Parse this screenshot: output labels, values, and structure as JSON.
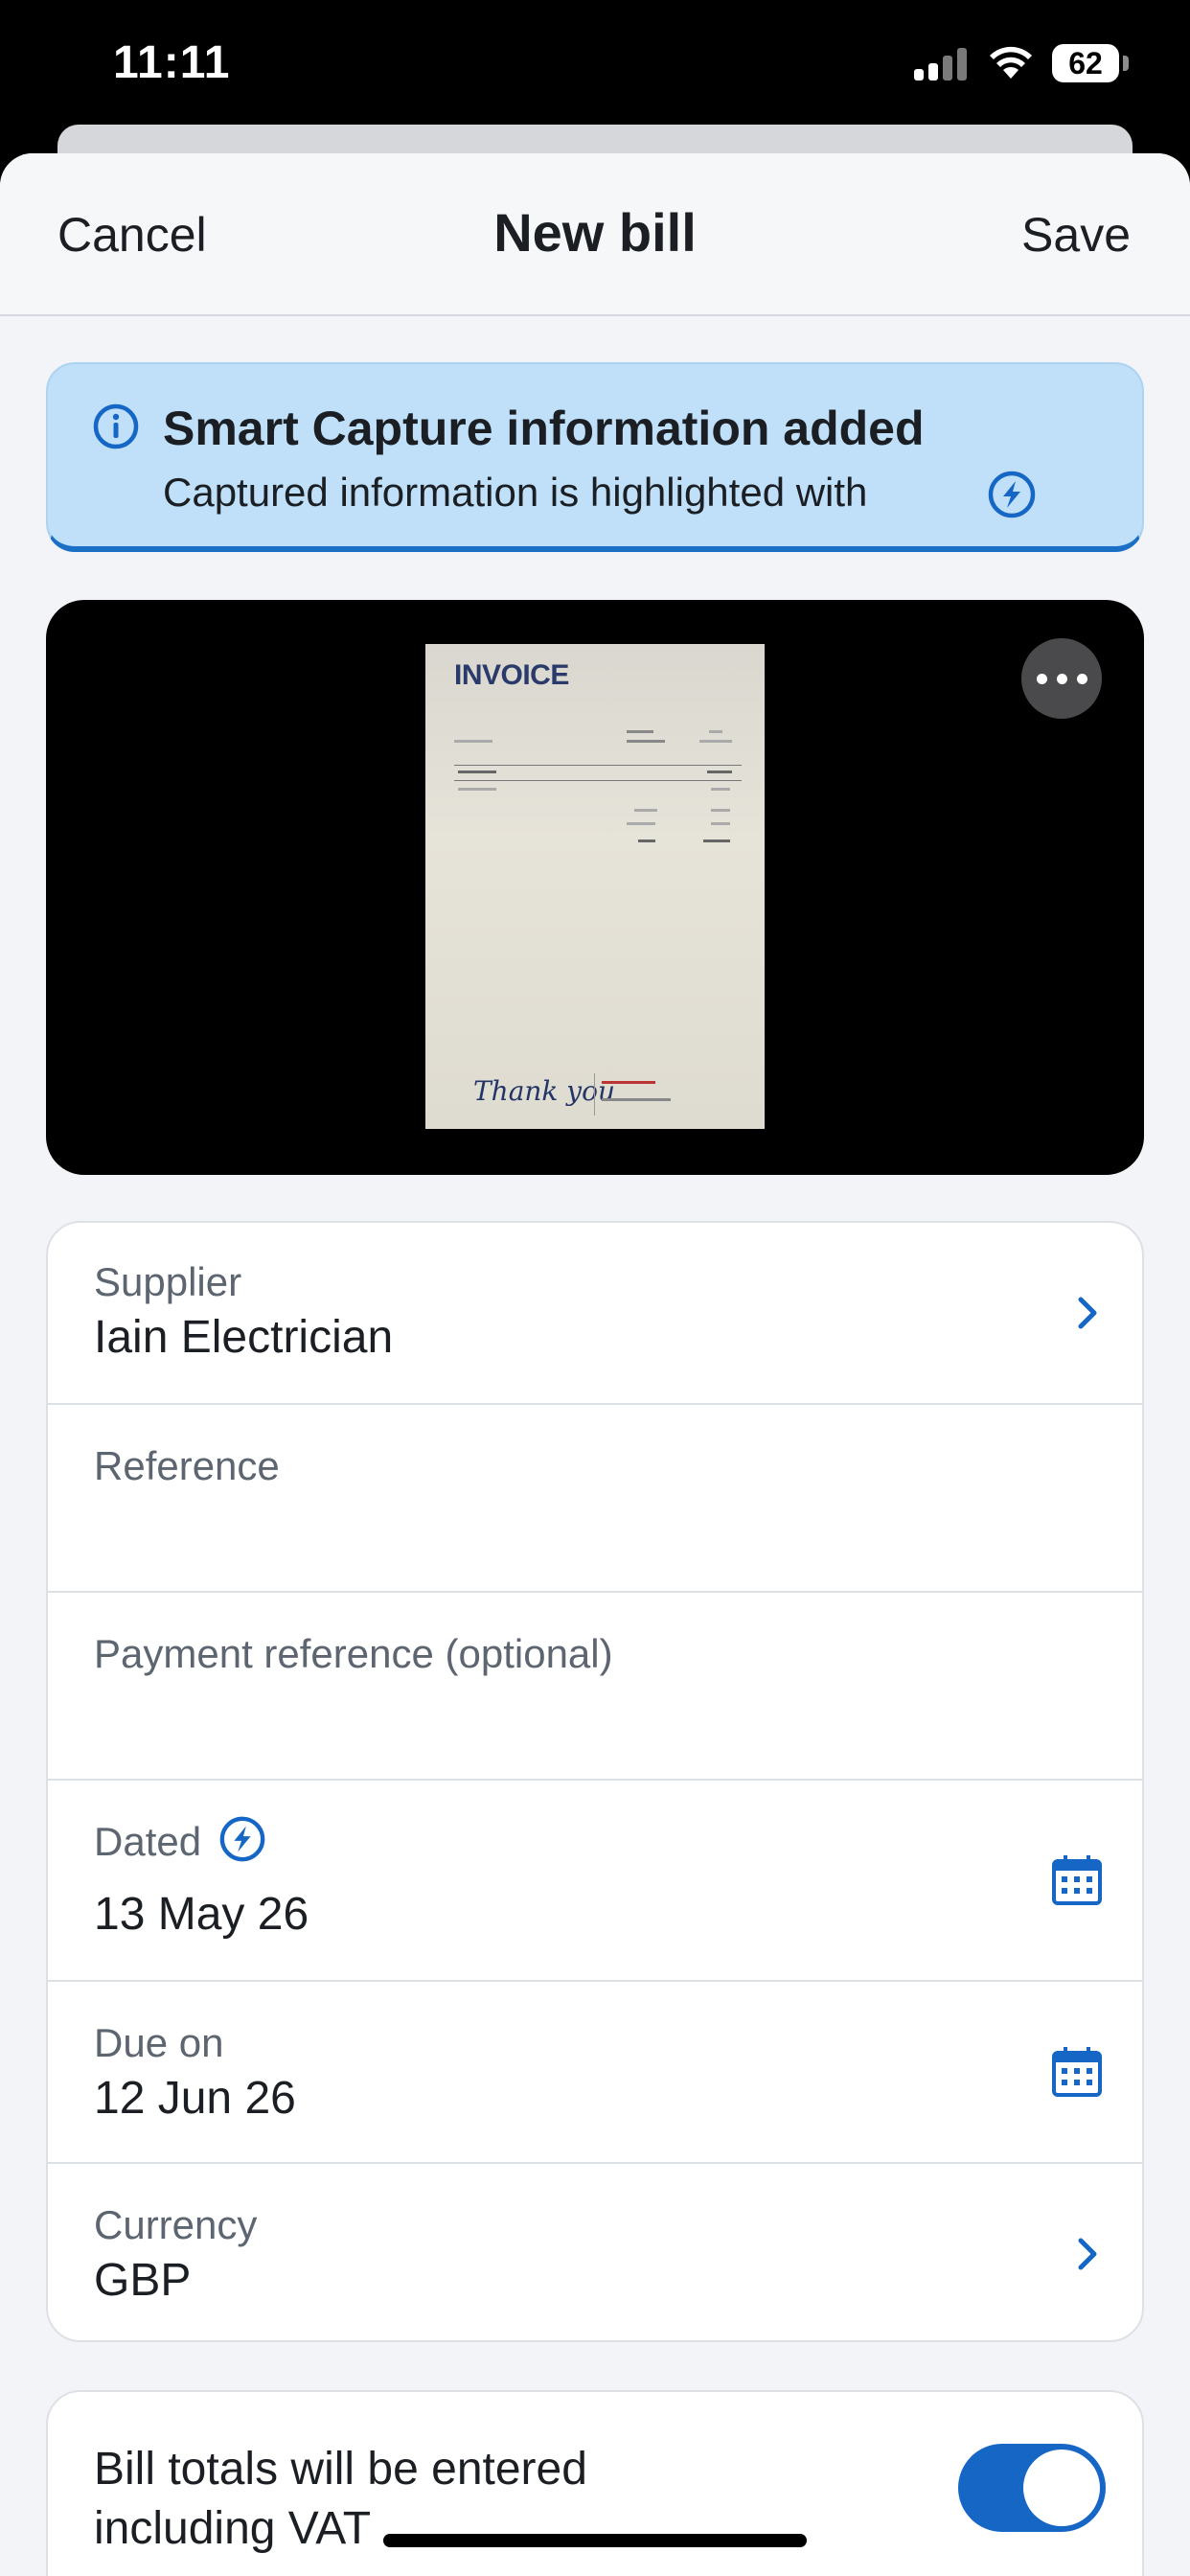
{
  "status_bar": {
    "time": "11:11",
    "battery": "62"
  },
  "nav": {
    "cancel_label": "Cancel",
    "title": "New bill",
    "save_label": "Save"
  },
  "banner": {
    "title": "Smart Capture information added",
    "text": "Captured information is highlighted with",
    "icons": [
      "info-icon",
      "smart-capture-icon"
    ]
  },
  "attachment": {
    "invoice_title": "INVOICE",
    "thanks_text": "Thank you",
    "more_icon": "ellipsis-icon"
  },
  "form": {
    "supplier": {
      "label": "Supplier",
      "value": "Iain Electrician"
    },
    "reference": {
      "label": "Reference",
      "value": ""
    },
    "payment_reference": {
      "label": "Payment reference (optional)",
      "value": ""
    },
    "dated": {
      "label": "Dated",
      "value": "13 May 26"
    },
    "due_on": {
      "label": "Due on",
      "value": "12 Jun 26"
    },
    "currency": {
      "label": "Currency",
      "value": "GBP"
    }
  },
  "vat": {
    "text": "Bill totals will be entered including VAT",
    "enabled": true
  },
  "colors": {
    "accent": "#1667c5",
    "banner_bg": "#bfe0f8",
    "page_bg": "#f2f4f8"
  }
}
